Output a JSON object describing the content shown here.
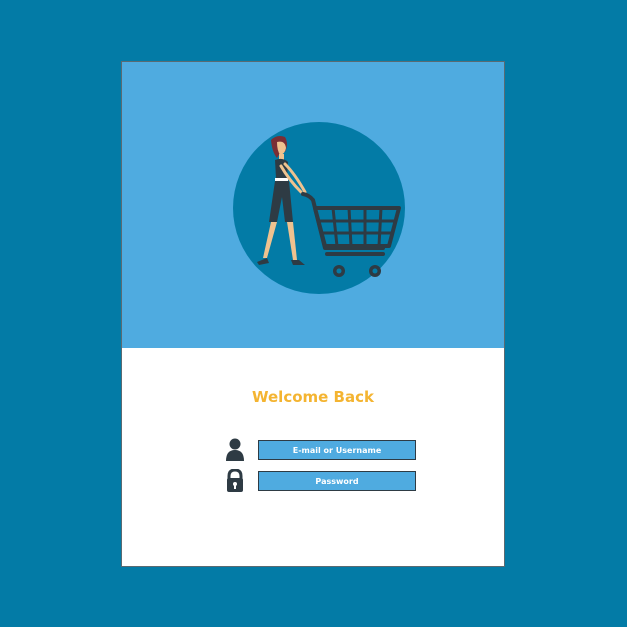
{
  "login": {
    "welcome": "Welcome Back",
    "email_placeholder": "E-mail or Username",
    "password_placeholder": "Password"
  },
  "icons": {
    "user": "user-icon",
    "lock": "lock-icon",
    "hero": "shopping-woman-cart-illustration"
  },
  "colors": {
    "page_background": "#037ba6",
    "hero_background": "#4fabe0",
    "accent_text": "#f4b431",
    "input_background": "#4fabe0",
    "icon_dark": "#2e3b44"
  }
}
